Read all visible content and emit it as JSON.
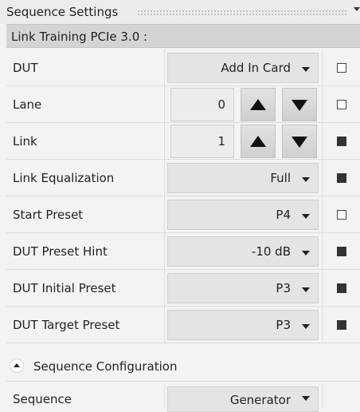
{
  "panel": {
    "title": "Sequence Settings"
  },
  "section": {
    "title": "Link Training PCIe 3.0 :"
  },
  "rows": [
    {
      "label": "DUT",
      "type": "dropdown",
      "value": "Add In Card",
      "checked": false
    },
    {
      "label": "Lane",
      "type": "spinner",
      "value": "0",
      "checked": false
    },
    {
      "label": "Link",
      "type": "spinner",
      "value": "1",
      "checked": true
    },
    {
      "label": "Link Equalization",
      "type": "dropdown",
      "value": "Full",
      "checked": true
    },
    {
      "label": "Start Preset",
      "type": "dropdown",
      "value": "P4",
      "checked": false
    },
    {
      "label": "DUT Preset Hint",
      "type": "dropdown",
      "value": "-10 dB",
      "checked": true
    },
    {
      "label": "DUT Initial Preset",
      "type": "dropdown",
      "value": "P3",
      "checked": true
    },
    {
      "label": "DUT Target Preset",
      "type": "dropdown",
      "value": "P3",
      "checked": true
    }
  ],
  "config": {
    "label": "Sequence Configuration"
  },
  "sequence": {
    "label": "Sequence",
    "value": "Generator"
  },
  "icons": {
    "collapse": "chevron-up-icon",
    "spin_up": "triangle-up-icon",
    "spin_down": "triangle-down-icon",
    "dropdown": "caret-down-icon"
  },
  "colors": {
    "background": "#f3f3f3",
    "section_header": "#d4d4d4",
    "control": "#e4e4e4"
  }
}
